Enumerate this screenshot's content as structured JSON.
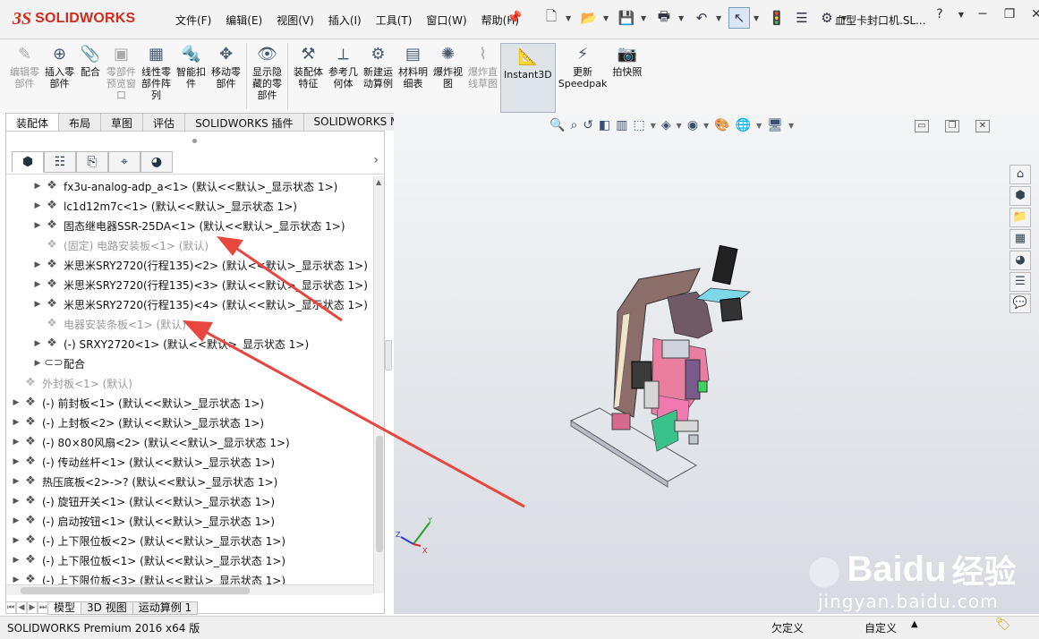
{
  "app": {
    "logo_ds": "3S",
    "logo_text": "SOLIDWORKS",
    "document_title": "血型卡封口机.SL...",
    "help": "?"
  },
  "menu": [
    "文件(F)",
    "编辑(E)",
    "视图(V)",
    "插入(I)",
    "工具(T)",
    "窗口(W)",
    "帮助(H)"
  ],
  "quick_access": {
    "icons": [
      "new-document-icon",
      "open-icon",
      "save-icon",
      "print-icon",
      "undo-icon",
      "select-pointer-icon",
      "traffic-light-icon",
      "properties-icon",
      "options-gear-icon"
    ]
  },
  "command_manager": {
    "items": [
      {
        "label": "编辑零\n部件",
        "icon": "edit-component-icon",
        "disabled": true
      },
      {
        "label": "插入零\n部件",
        "icon": "insert-component-icon",
        "disabled": false
      },
      {
        "label": "配合",
        "icon": "mate-icon",
        "disabled": false
      },
      {
        "label": "零部件\n预览窗\n口",
        "icon": "component-preview-icon",
        "disabled": true
      },
      {
        "label": "线性零\n部件阵\n列",
        "icon": "linear-pattern-icon",
        "disabled": false
      },
      {
        "label": "智能扣\n件",
        "icon": "smart-fasteners-icon",
        "disabled": false
      },
      {
        "label": "移动零\n部件",
        "icon": "move-component-icon",
        "disabled": false
      },
      {
        "label": "显示隐\n藏的零\n部件",
        "icon": "show-hidden-icon",
        "disabled": false
      },
      {
        "label": "装配体\n特征",
        "icon": "assembly-features-icon",
        "disabled": false
      },
      {
        "label": "参考几\n何体",
        "icon": "reference-geometry-icon",
        "disabled": false
      },
      {
        "label": "新建运\n动算例",
        "icon": "motion-study-icon",
        "disabled": false
      },
      {
        "label": "材料明\n细表",
        "icon": "bom-icon",
        "disabled": false
      },
      {
        "label": "爆炸视\n图",
        "icon": "exploded-view-icon",
        "disabled": false
      },
      {
        "label": "爆炸直\n线草图",
        "icon": "explode-line-sketch-icon",
        "disabled": true
      },
      {
        "label": "Instant3D",
        "icon": "instant3d-icon",
        "disabled": false,
        "active": true
      },
      {
        "label": "更新\nSpeedpak",
        "icon": "speedpak-icon",
        "disabled": false
      },
      {
        "label": "拍快照",
        "icon": "camera-icon",
        "disabled": false
      }
    ]
  },
  "tabs": [
    "装配体",
    "布局",
    "草图",
    "评估",
    "SOLIDWORKS 插件",
    "SOLIDWORKS MBD"
  ],
  "feature_tree": {
    "rows": [
      {
        "text": "fx3u-analog-adp_a<1> (默认<<默认>_显示状态 1>)",
        "indent": 1,
        "expand": true,
        "dim": false
      },
      {
        "text": "lc1d12m7c<1> (默认<<默认>_显示状态 1>)",
        "indent": 1,
        "expand": true,
        "dim": false
      },
      {
        "text": "固态继电器SSR-25DA<1> (默认<<默认>_显示状态 1>)",
        "indent": 1,
        "expand": true,
        "dim": false
      },
      {
        "text": "(固定) 电路安装板<1> (默认)",
        "indent": 1,
        "expand": false,
        "dim": true
      },
      {
        "text": "米思米SRY2720(行程135)<2> (默认<<默认>_显示状态 1>)",
        "indent": 1,
        "expand": true,
        "dim": false
      },
      {
        "text": "米思米SRY2720(行程135)<3> (默认<<默认>_显示状态 1>)",
        "indent": 1,
        "expand": true,
        "dim": false
      },
      {
        "text": "米思米SRY2720(行程135)<4> (默认<<默认>_显示状态 1>)",
        "indent": 1,
        "expand": true,
        "dim": false
      },
      {
        "text": "电器安装条板<1> (默认)",
        "indent": 1,
        "expand": false,
        "dim": true
      },
      {
        "text": "(-) SRXY2720<1> (默认<<默认>_显示状态 1>)",
        "indent": 1,
        "expand": true,
        "dim": false
      },
      {
        "text": "配合",
        "indent": 1,
        "expand": true,
        "dim": false,
        "icon": "mates-icon"
      },
      {
        "text": "外封板<1> (默认)",
        "indent": 0,
        "expand": false,
        "dim": true
      },
      {
        "text": "(-) 前封板<1> (默认<<默认>_显示状态 1>)",
        "indent": 0,
        "expand": true,
        "dim": false
      },
      {
        "text": "(-) 上封板<2> (默认<<默认>_显示状态 1>)",
        "indent": 0,
        "expand": true,
        "dim": false
      },
      {
        "text": "(-) 80×80风扇<2> (默认<<默认>_显示状态 1>)",
        "indent": 0,
        "expand": true,
        "dim": false
      },
      {
        "text": "(-) 传动丝杆<1> (默认<<默认>_显示状态 1>)",
        "indent": 0,
        "expand": true,
        "dim": false
      },
      {
        "text": "热压底板<2>->? (默认<<默认>_显示状态 1>)",
        "indent": 0,
        "expand": true,
        "dim": false
      },
      {
        "text": "(-) 旋钮开关<1> (默认<<默认>_显示状态 1>)",
        "indent": 0,
        "expand": true,
        "dim": false
      },
      {
        "text": "(-) 启动按钮<1> (默认<<默认>_显示状态 1>)",
        "indent": 0,
        "expand": true,
        "dim": false
      },
      {
        "text": "(-) 上下限位板<2> (默认<<默认>_显示状态 1>)",
        "indent": 0,
        "expand": true,
        "dim": false
      },
      {
        "text": "(-) 上下限位板<1> (默认<<默认>_显示状态 1>)",
        "indent": 0,
        "expand": true,
        "dim": false
      },
      {
        "text": "(-) 上下限位板<3> (默认<<默认>_显示状态 1>)",
        "indent": 0,
        "expand": true,
        "dim": false
      }
    ]
  },
  "bottom_tabs": [
    "模型",
    "3D 视图",
    "运动算例 1"
  ],
  "status": {
    "product": "SOLIDWORKS Premium 2016 x64 版",
    "state": "欠定义",
    "units": "自定义",
    "units_caret": "▲"
  },
  "viewport": {
    "triad_axes": [
      "X",
      "Y",
      "Z"
    ],
    "annotation_color": "#e8473f"
  },
  "watermark": {
    "brand": "Baidu",
    "cn": "经验",
    "url": "jingyan.baidu.com"
  }
}
